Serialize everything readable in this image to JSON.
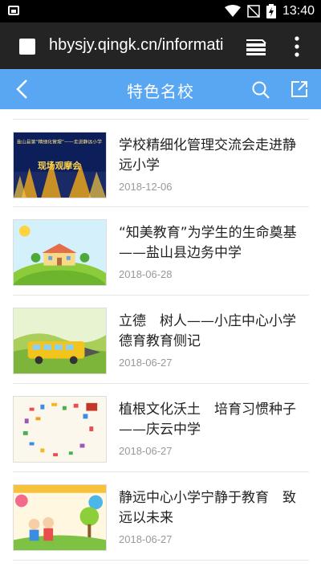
{
  "status_bar": {
    "time": "13:40"
  },
  "browser": {
    "url": "hbysjy.qingk.cn/informati"
  },
  "header": {
    "title": "特色名校"
  },
  "colors": {
    "accent": "#59a7f2",
    "browser_bar": "#242424",
    "status_bar": "#000000"
  },
  "articles": [
    {
      "title": "学校精细化管理交流会走进静远小学",
      "date": "2018-12-06",
      "thumb_text": "盐山县第“精细化管理”——走进静远小学",
      "thumb_banner": "现场观摩会"
    },
    {
      "title": "“知美教育”为学生的生命奠基——盐山县边务中学",
      "date": "2018-06-28"
    },
    {
      "title": "立德　树人——小庄中心小学德育教育侧记",
      "date": "2018-06-27"
    },
    {
      "title": "植根文化沃土　培育习惯种子——庆云中学",
      "date": "2018-06-27"
    },
    {
      "title": "静远中心小学宁静于教育　致远以未来",
      "date": "2018-06-27"
    }
  ]
}
